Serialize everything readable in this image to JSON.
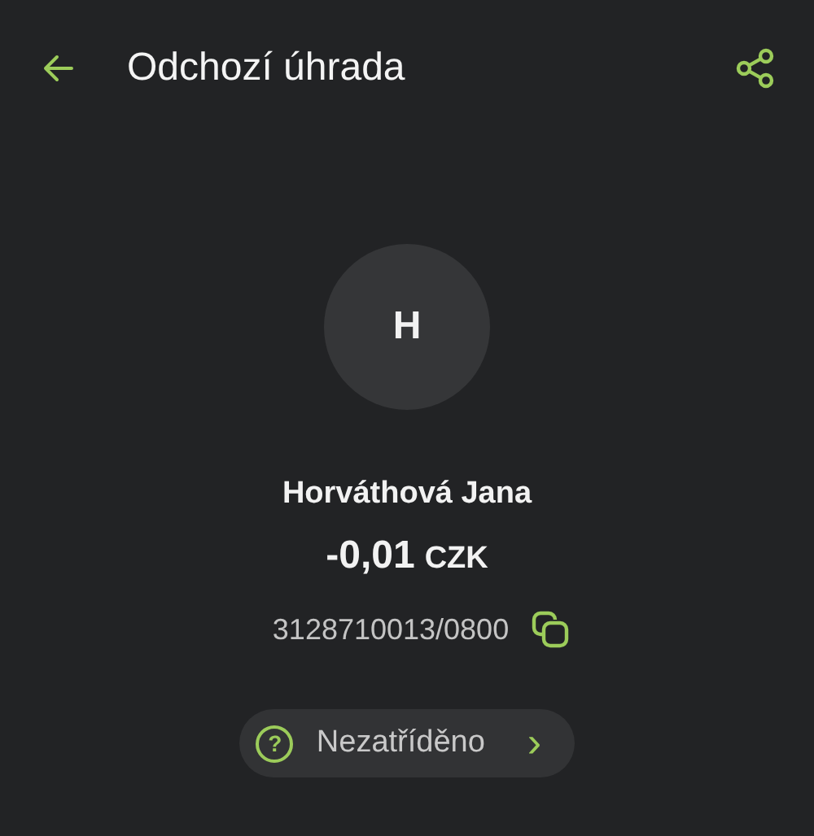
{
  "header": {
    "title": "Odchozí úhrada"
  },
  "counterparty": {
    "initial": "H",
    "name": "Horváthová Jana",
    "amount": "-0,01",
    "currency": "CZK",
    "account": "3128710013/0800"
  },
  "category": {
    "icon": "?",
    "label": "Nezatříděno",
    "arrow": "›"
  }
}
